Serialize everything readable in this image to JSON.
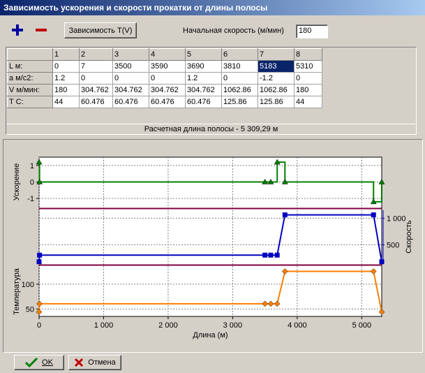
{
  "window": {
    "title": "Зависимость ускорения и скорости прокатки  от длины полосы"
  },
  "toolbar": {
    "add_icon": "plus-icon",
    "remove_icon": "minus-icon",
    "dependency_label": "Зависимость T(V)",
    "speed_label": "Начальная скорость (м/мин)",
    "speed_value": "180"
  },
  "table": {
    "columns": [
      "1",
      "2",
      "3",
      "4",
      "5",
      "6",
      "7",
      "8"
    ],
    "rows": [
      {
        "label": "L м:",
        "values": [
          "0",
          "7",
          "3500",
          "3590",
          "3690",
          "3810",
          "5183",
          "5310"
        ]
      },
      {
        "label": "a м/c2:",
        "values": [
          "1.2",
          "0",
          "0",
          "0",
          "1.2",
          "0",
          "-1.2",
          "0"
        ]
      },
      {
        "label": "V м/мин:",
        "values": [
          "180",
          "304.762",
          "304.762",
          "304.762",
          "304.762",
          "1062.86",
          "1062.86",
          "180"
        ]
      },
      {
        "label": "T C:",
        "values": [
          "44",
          "60.476",
          "60.476",
          "60.476",
          "60.476",
          "125.86",
          "125.86",
          "44"
        ]
      }
    ],
    "selected": {
      "row": 0,
      "col": 6
    },
    "calc_length": "Расчетная длина полосы - 5 309,29 м"
  },
  "chart_data": {
    "type": "line",
    "xlabel": "Длина (м)",
    "x_ticks": [
      "0",
      "1 000",
      "2 000",
      "3 000",
      "4 000",
      "5 000"
    ],
    "xlim": [
      0,
      5310
    ],
    "panels": [
      {
        "ylabel": "Ускорение",
        "ylim": [
          -1.5,
          1.5
        ],
        "ticks": [
          "1",
          "0",
          "-1"
        ],
        "tick_values": [
          1,
          0,
          -1
        ],
        "color": "#008000",
        "marker": "triangle",
        "step": true,
        "points": [
          [
            0,
            1.2
          ],
          [
            7,
            0
          ],
          [
            3500,
            0
          ],
          [
            3590,
            0
          ],
          [
            3690,
            1.2
          ],
          [
            3810,
            0
          ],
          [
            5183,
            -1.2
          ],
          [
            5310,
            0
          ]
        ]
      },
      {
        "ylabel": "Скорость",
        "ylim": [
          150,
          1150
        ],
        "ticks": [
          "1 000",
          "500"
        ],
        "tick_values": [
          1000,
          500
        ],
        "color": "#0000c0",
        "marker": "square",
        "step": false,
        "axis": "right",
        "points": [
          [
            0,
            180
          ],
          [
            7,
            304.762
          ],
          [
            3500,
            304.762
          ],
          [
            3590,
            304.762
          ],
          [
            3690,
            304.762
          ],
          [
            3810,
            1062.86
          ],
          [
            5183,
            1062.86
          ],
          [
            5310,
            180
          ]
        ]
      },
      {
        "ylabel": "Температура",
        "ylim": [
          35,
          135
        ],
        "ticks": [
          "100",
          "50"
        ],
        "tick_values": [
          100,
          50
        ],
        "color": "#ff8000",
        "marker": "diamond",
        "step": false,
        "points": [
          [
            0,
            44
          ],
          [
            7,
            60.476
          ],
          [
            3500,
            60.476
          ],
          [
            3590,
            60.476
          ],
          [
            3690,
            60.476
          ],
          [
            3810,
            125.86
          ],
          [
            5183,
            125.86
          ],
          [
            5310,
            44
          ]
        ]
      }
    ],
    "grid": true,
    "separator_color": "#800040"
  },
  "footer": {
    "ok_label": "OK",
    "cancel_label": "Отмена"
  }
}
